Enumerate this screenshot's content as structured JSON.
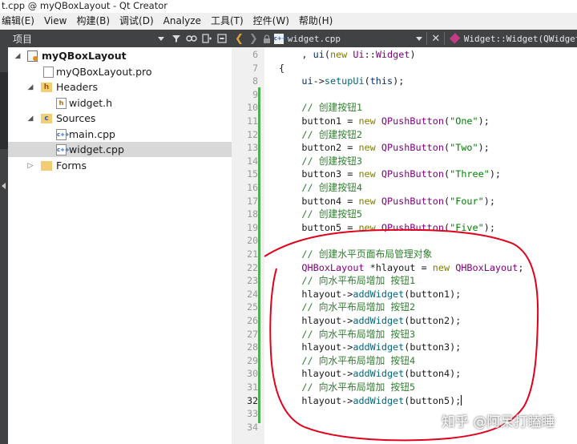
{
  "window": {
    "title": "t.cpp @ myQBoxLayout - Qt Creator"
  },
  "menu": [
    "编辑(E)",
    "View",
    "构建(B)",
    "调试(D)",
    "Analyze",
    "工具(T)",
    "控件(W)",
    "帮助(H)"
  ],
  "project_panel": {
    "title": "项目",
    "tree": [
      {
        "label": "myQBoxLayout",
        "level": 0,
        "expanded": true,
        "icon": "project-icon",
        "bold": true
      },
      {
        "label": "myQBoxLayout.pro",
        "level": 1,
        "icon": "pro-file-icon"
      },
      {
        "label": "Headers",
        "level": 1,
        "expanded": true,
        "icon": "headers-folder-icon"
      },
      {
        "label": "widget.h",
        "level": 2,
        "icon": "header-file-icon"
      },
      {
        "label": "Sources",
        "level": 1,
        "expanded": true,
        "icon": "sources-folder-icon"
      },
      {
        "label": "main.cpp",
        "level": 2,
        "icon": "cpp-file-icon"
      },
      {
        "label": "widget.cpp",
        "level": 2,
        "icon": "cpp-file-icon",
        "selected": true
      },
      {
        "label": "Forms",
        "level": 1,
        "expanded": false,
        "icon": "forms-folder-icon"
      }
    ]
  },
  "editor": {
    "file_tab": "widget.cpp",
    "function_selector": "Widget::Widget(QWidget *",
    "current_line": "32",
    "lines": [
      {
        "n": "6",
        "text": "    , ui(new Ui::Widget)"
      },
      {
        "n": "7",
        "text": "{"
      },
      {
        "n": "8",
        "text": "    ui->setupUi(this);"
      },
      {
        "n": "9",
        "text": ""
      },
      {
        "n": "10",
        "text": "    // 创建按钮1"
      },
      {
        "n": "11",
        "text": "    button1 = new QPushButton(\"One\");"
      },
      {
        "n": "12",
        "text": "    // 创建按钮2"
      },
      {
        "n": "13",
        "text": "    button2 = new QPushButton(\"Two\");"
      },
      {
        "n": "14",
        "text": "    // 创建按钮3"
      },
      {
        "n": "15",
        "text": "    button3 = new QPushButton(\"Three\");"
      },
      {
        "n": "16",
        "text": "    // 创建按钮4"
      },
      {
        "n": "17",
        "text": "    button4 = new QPushButton(\"Four\");"
      },
      {
        "n": "18",
        "text": "    // 创建按钮5"
      },
      {
        "n": "19",
        "text": "    button5 = new QPushButton(\"Five\");"
      },
      {
        "n": "20",
        "text": ""
      },
      {
        "n": "21",
        "text": "    // 创建水平页面布局管理对象"
      },
      {
        "n": "22",
        "text": "    QHBoxLayout *hlayout = new QHBoxLayout;"
      },
      {
        "n": "23",
        "text": "    // 向水平布局增加 按钮1"
      },
      {
        "n": "24",
        "text": "    hlayout->addWidget(button1);"
      },
      {
        "n": "25",
        "text": "    // 向水平布局增加 按钮2"
      },
      {
        "n": "26",
        "text": "    hlayout->addWidget(button2);"
      },
      {
        "n": "27",
        "text": "    // 向水平布局增加 按钮3"
      },
      {
        "n": "28",
        "text": "    hlayout->addWidget(button3);"
      },
      {
        "n": "29",
        "text": "    // 向水平布局增加 按钮4"
      },
      {
        "n": "30",
        "text": "    hlayout->addWidget(button4);"
      },
      {
        "n": "31",
        "text": "    // 向水平布局增加 按钮5"
      },
      {
        "n": "32",
        "text": "    hlayout->addWidget(button5);"
      },
      {
        "n": "33",
        "text": ""
      },
      {
        "n": "34",
        "text": ""
      }
    ]
  },
  "annotation_color": "#e0001b",
  "watermark": "知乎 @阿呆打瞌睡"
}
